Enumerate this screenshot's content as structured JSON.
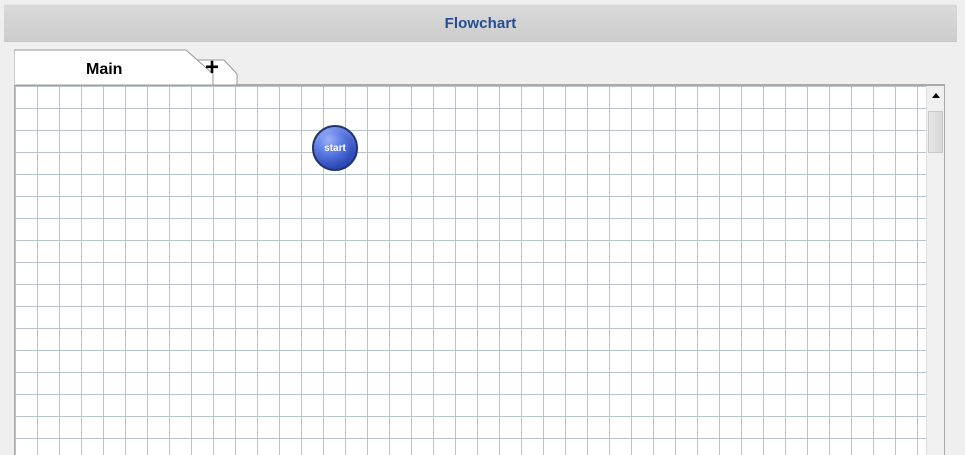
{
  "window": {
    "title": "Flowchart"
  },
  "tabs": [
    {
      "label": "Main",
      "selected": true
    },
    {
      "label": "+",
      "selected": false
    }
  ],
  "canvas": {
    "nodes": [
      {
        "label": "start",
        "shape": "circle"
      }
    ]
  },
  "scrollbar": {
    "up_icon": "up-arrow-icon"
  },
  "colors": {
    "title_text": "#264c91",
    "node_blue": "#2e4bb8",
    "grid_line": "#b5c4cf"
  }
}
